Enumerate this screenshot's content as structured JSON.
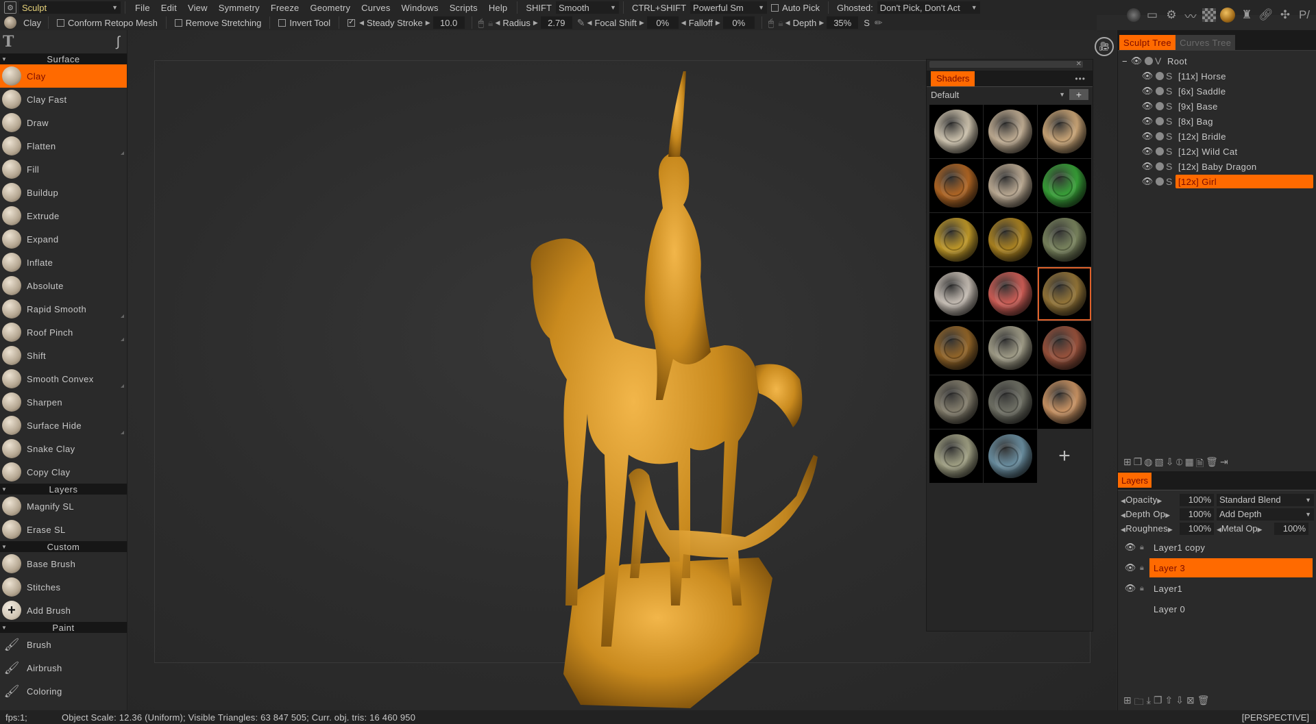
{
  "menubar": {
    "room": "Sculpt",
    "items": [
      "File",
      "Edit",
      "View",
      "Symmetry",
      "Freeze",
      "Geometry",
      "Curves",
      "Windows",
      "Scripts",
      "Help"
    ],
    "shift_label": "SHIFT",
    "shift_value": "Smooth",
    "ctrl_shift_label": "CTRL+SHIFT",
    "ctrl_shift_value": "Powerful Sm",
    "auto_pick": "Auto Pick",
    "ghosted_label": "Ghosted:",
    "ghosted_value": "Don't Pick, Don't Act"
  },
  "toolbar": {
    "current_brush": "Clay",
    "conform_retopo": "Conform Retopo Mesh",
    "remove_stretching": "Remove Stretching",
    "invert_tool": "Invert Tool",
    "steady_stroke_label": "Steady Stroke",
    "steady_stroke_checked": true,
    "steady_stroke_value": "10.0",
    "radius_label": "Radius",
    "radius_value": "2.79",
    "focal_shift_label": "Focal Shift",
    "focal_shift_value": "0%",
    "falloff_label": "Falloff",
    "falloff_value": "0%",
    "depth_label": "Depth",
    "depth_value": "35%",
    "s_label": "S"
  },
  "top_icons": [
    "light-icon",
    "frame-icon",
    "settings-brush-icon",
    "curves-icon",
    "checker-icon",
    "material-icon",
    "mask-icon",
    "link-icon",
    "bug-icon",
    "paint-brush-icon"
  ],
  "left_panel": {
    "sections": [
      {
        "title": "Surface",
        "brushes": [
          "Clay",
          "Clay Fast",
          "Draw",
          "Flatten",
          "Fill",
          "Buildup",
          "Extrude",
          "Expand",
          "Inflate",
          "Absolute",
          "Rapid Smooth",
          "Roof Pinch",
          "Shift",
          "Smooth Convex",
          "Sharpen",
          "Surface Hide",
          "Snake Clay",
          "Copy Clay"
        ]
      },
      {
        "title": "Layers",
        "brushes": [
          "Magnify SL",
          "Erase SL"
        ]
      },
      {
        "title": "Custom",
        "brushes": [
          "Base Brush",
          "Stitches",
          "Add Brush"
        ]
      },
      {
        "title": "Paint",
        "brushes": [
          "Brush",
          "Airbrush",
          "Coloring"
        ]
      }
    ],
    "active_brush": "Clay"
  },
  "shaders": {
    "tab": "Shaders",
    "preset": "Default",
    "swatches": [
      "#d6cbb5",
      "#c9b59a",
      "#d4ad7c",
      "#b86a25",
      "#c4b29a",
      "#3aa83a",
      "#c9a02a",
      "#b58a22",
      "#7f8a62",
      "#cfc6bc",
      "#d8625a",
      "#9a7a3a",
      "#9a6a2a",
      "#a8a48e",
      "#a0553e",
      "#8a8472",
      "#75766a",
      "#d39a68",
      "#a8a88a",
      "#6f95a8"
    ],
    "selected_index": 11
  },
  "sculpt_tree": {
    "tabs": [
      "Sculpt Tree",
      "Curves Tree"
    ],
    "root": {
      "type": "V",
      "name": "Root"
    },
    "items": [
      {
        "type": "S",
        "name": "[11x] Horse"
      },
      {
        "type": "S",
        "name": "[6x] Saddle"
      },
      {
        "type": "S",
        "name": "[9x] Base"
      },
      {
        "type": "S",
        "name": "[8x] Bag"
      },
      {
        "type": "S",
        "name": "[12x] Bridle"
      },
      {
        "type": "S",
        "name": "[12x] Wild Cat"
      },
      {
        "type": "S",
        "name": "[12x] Baby Dragon"
      },
      {
        "type": "S",
        "name": "[12x] Girl"
      }
    ],
    "active": "[12x] Girl"
  },
  "layers": {
    "tab": "Layers",
    "opacity_label": "Opacity",
    "opacity_value": "100%",
    "blend_mode": "Standard Blend",
    "depth_op_label": "Depth Op",
    "depth_op_value": "100%",
    "depth_mode": "Add Depth",
    "roughness_label": "Roughnes",
    "roughness_value": "100%",
    "metal_op_label": "Metal Op",
    "metal_op_value": "100%",
    "items": [
      {
        "name": "Layer1 copy",
        "visible": true
      },
      {
        "name": "Layer 3",
        "visible": true
      },
      {
        "name": "Layer1",
        "visible": true
      },
      {
        "name": "Layer 0",
        "visible": false
      }
    ],
    "active": "Layer 3"
  },
  "status": {
    "fps": "fps:1;",
    "info": "Object Scale: 12.36 (Uniform); Visible Triangles: 63 847 505; Curr. obj. tris: 16 460 950",
    "projection": "[PERSPECTIVE]"
  },
  "colors": {
    "accent": "#ff6a00",
    "accent_text": "#7a0a00",
    "room_text": "#e7d27a",
    "sculpt_gold": "#c98a1e"
  }
}
